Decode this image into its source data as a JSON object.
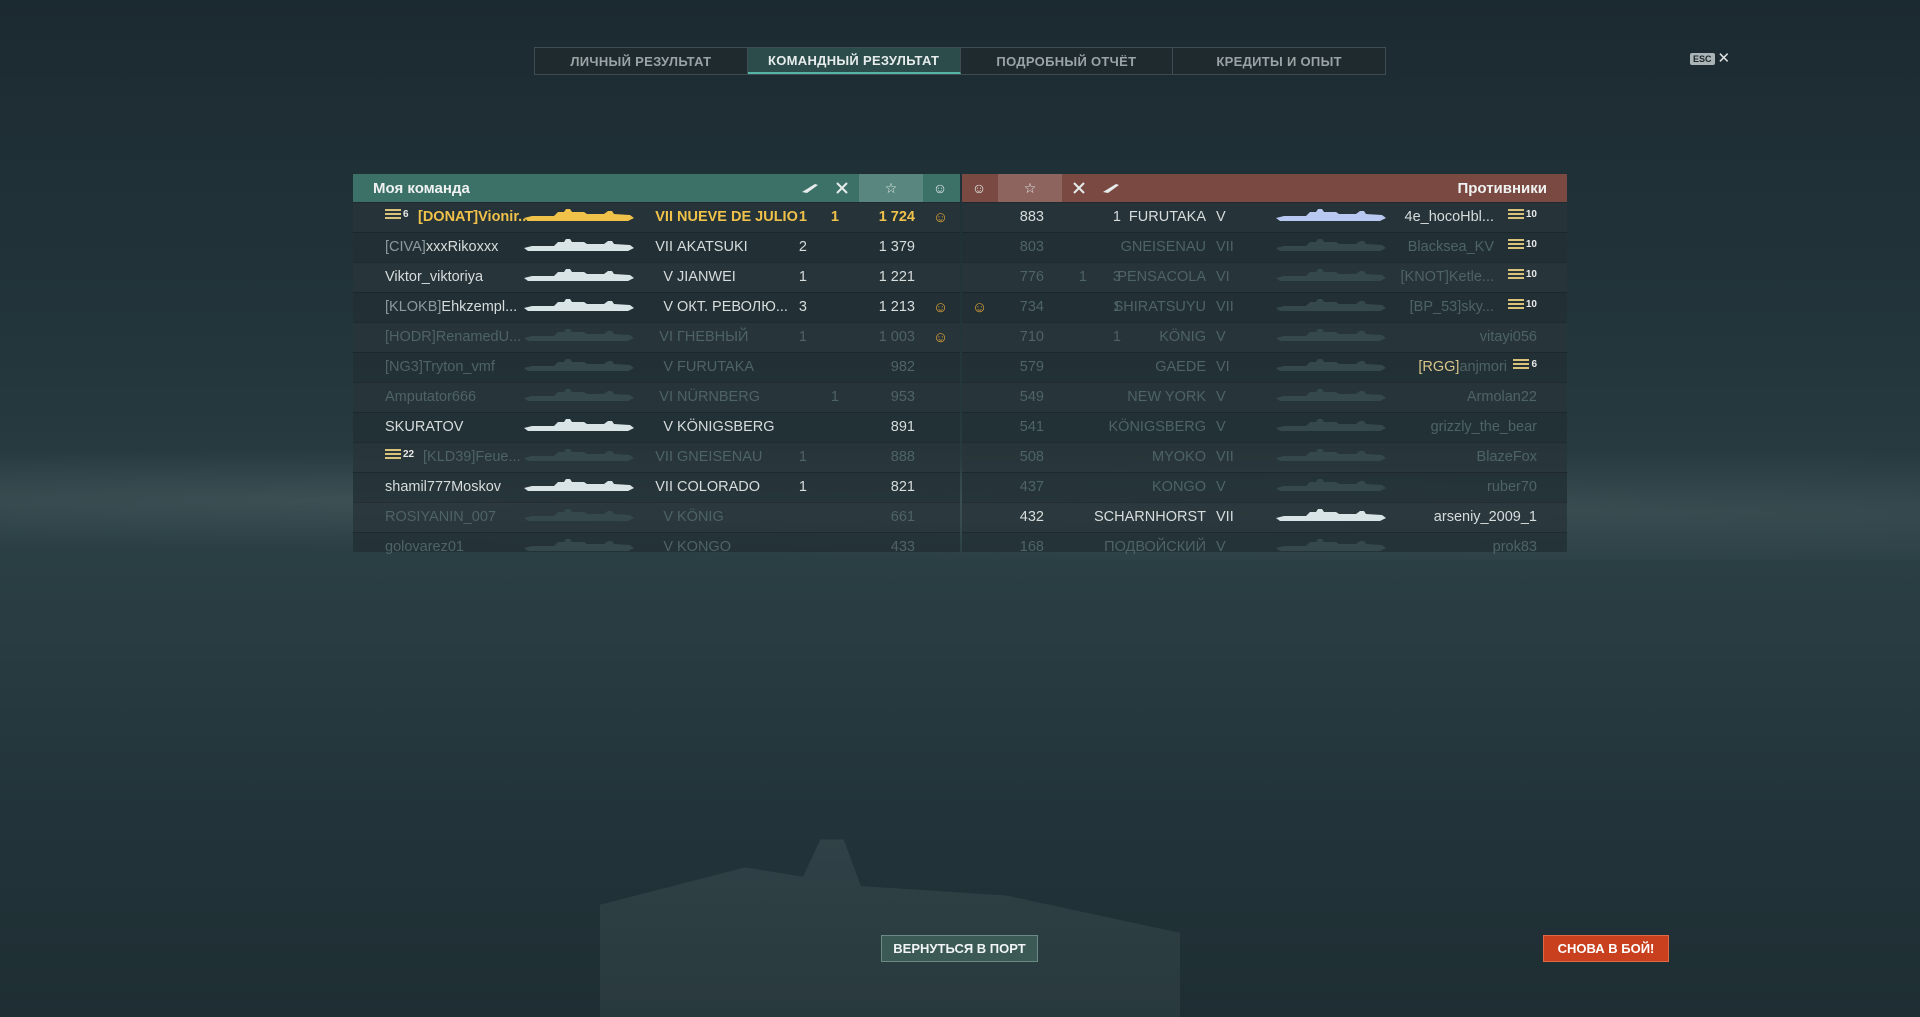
{
  "tabs": [
    {
      "label": "ЛИЧНЫЙ РЕЗУЛЬТАТ",
      "active": false
    },
    {
      "label": "КОМАНДНЫЙ РЕЗУЛЬТАТ",
      "active": true
    },
    {
      "label": "ПОДРОБНЫЙ ОТЧЁТ",
      "active": false
    },
    {
      "label": "КРЕДИТЫ И ОПЫТ",
      "active": false
    }
  ],
  "esc_label": "ESC",
  "close_glyph": "✕",
  "my_team": {
    "title": "Моя команда",
    "header_icons": [
      "ship-kill-icon",
      "plane-kill-icon",
      "star-icon",
      "smile-icon"
    ],
    "rows": [
      {
        "medal": "6",
        "clan": "[DONAT]",
        "name": "Vionir...",
        "tier": "VII",
        "ship": "NUEVE DE JULIO",
        "ships": "1",
        "planes": "1",
        "score": "1 724",
        "smile": true,
        "style": "gold"
      },
      {
        "clan": "[CIVA]",
        "name": "xxxRikoxxx",
        "tier": "VII",
        "ship": "AKATSUKI",
        "ships": "2",
        "planes": "",
        "score": "1 379",
        "smile": false,
        "style": "alive"
      },
      {
        "clan": "",
        "name": "Viktor_viktoriya",
        "tier": "V",
        "ship": "JIANWEI",
        "ships": "1",
        "planes": "",
        "score": "1 221",
        "smile": false,
        "style": "alive"
      },
      {
        "clan": "[KLOKB]",
        "name": "Ehkzempl...",
        "tier": "V",
        "ship": "ОКТ. РЕВОЛЮ...",
        "ships": "3",
        "planes": "",
        "score": "1 213",
        "smile": true,
        "style": "alive"
      },
      {
        "clan": "[HODR]",
        "name": "RenamedU...",
        "tier": "VI",
        "ship": "ГНЕВНЫЙ",
        "ships": "1",
        "planes": "",
        "score": "1 003",
        "smile": true,
        "style": "dim"
      },
      {
        "clan": "[NG3]",
        "name": "Tryton_vmf",
        "tier": "V",
        "ship": "FURUTAKA",
        "ships": "",
        "planes": "",
        "score": "982",
        "smile": false,
        "style": "dim"
      },
      {
        "clan": "",
        "name": "Amputator666",
        "tier": "VI",
        "ship": "NÜRNBERG",
        "ships": "",
        "planes": "1",
        "score": "953",
        "smile": false,
        "style": "dim"
      },
      {
        "clan": "",
        "name": "SKURATOV",
        "tier": "V",
        "ship": "KÖNIGSBERG",
        "ships": "",
        "planes": "",
        "score": "891",
        "smile": false,
        "style": "alive"
      },
      {
        "medal": "22",
        "clan": "[KLD39]",
        "name": "Feue...",
        "tier": "VII",
        "ship": "GNEISENAU",
        "ships": "1",
        "planes": "",
        "score": "888",
        "smile": false,
        "style": "dim"
      },
      {
        "clan": "",
        "name": "shamil777Moskov",
        "tier": "VII",
        "ship": "COLORADO",
        "ships": "1",
        "planes": "",
        "score": "821",
        "smile": false,
        "style": "alive"
      },
      {
        "clan": "",
        "name": "ROSIYANIN_007",
        "tier": "V",
        "ship": "KÖNIG",
        "ships": "",
        "planes": "",
        "score": "661",
        "smile": false,
        "style": "dim"
      },
      {
        "clan": "",
        "name": "golovarez01",
        "tier": "V",
        "ship": "KONGO",
        "ships": "",
        "planes": "",
        "score": "433",
        "smile": false,
        "style": "dim"
      }
    ]
  },
  "enemy_team": {
    "title": "Противники",
    "rows": [
      {
        "score": "883",
        "planes": "",
        "ships": "1",
        "ship": "FURUTAKA",
        "tier": "V",
        "clan": "",
        "name": "4e_hocoHbl...",
        "rank": "10",
        "smile": false,
        "style": "alive"
      },
      {
        "score": "803",
        "planes": "",
        "ships": "",
        "ship": "GNEISENAU",
        "tier": "VII",
        "clan": "",
        "name": "Blacksea_KV",
        "rank": "10",
        "smile": false,
        "style": "dim"
      },
      {
        "score": "776",
        "planes": "1",
        "ships": "3",
        "ship": "PENSACOLA",
        "tier": "VI",
        "clan": "[KNOT]",
        "name": "Ketle...",
        "rank": "10",
        "smile": false,
        "style": "dim"
      },
      {
        "score": "734",
        "planes": "",
        "ships": "1",
        "ship": "SHIRATSUYU",
        "tier": "VII",
        "clan": "[BP_53]",
        "name": "sky...",
        "rank": "10",
        "smile": true,
        "style": "dim"
      },
      {
        "score": "710",
        "planes": "",
        "ships": "1",
        "ship": "KÖNIG",
        "tier": "V",
        "clan": "",
        "name": "vitayi056",
        "rank": "",
        "smile": false,
        "style": "dim"
      },
      {
        "score": "579",
        "planes": "",
        "ships": "",
        "ship": "GAEDE",
        "tier": "VI",
        "clan": "[RGG]",
        "name": "anjmori",
        "rank": "6",
        "smile": false,
        "style": "dim"
      },
      {
        "score": "549",
        "planes": "",
        "ships": "",
        "ship": "NEW YORK",
        "tier": "V",
        "clan": "",
        "name": "Armolan22",
        "rank": "",
        "smile": false,
        "style": "dim"
      },
      {
        "score": "541",
        "planes": "",
        "ships": "",
        "ship": "KÖNIGSBERG",
        "tier": "V",
        "clan": "",
        "name": "grizzly_the_bear",
        "rank": "",
        "smile": false,
        "style": "dim"
      },
      {
        "score": "508",
        "planes": "",
        "ships": "",
        "ship": "MYOKO",
        "tier": "VII",
        "clan": "",
        "name": "BlazeFox",
        "rank": "",
        "smile": false,
        "style": "dim"
      },
      {
        "score": "437",
        "planes": "",
        "ships": "",
        "ship": "KONGO",
        "tier": "V",
        "clan": "",
        "name": "ruber70",
        "rank": "",
        "smile": false,
        "style": "dim"
      },
      {
        "score": "432",
        "planes": "",
        "ships": "",
        "ship": "SCHARNHORST",
        "tier": "VII",
        "clan": "",
        "name": "arseniy_2009_1",
        "rank": "",
        "smile": false,
        "style": "alive"
      },
      {
        "score": "168",
        "planes": "",
        "ships": "",
        "ship": "ПОДВОЙСКИЙ",
        "tier": "V",
        "clan": "",
        "name": "prok83",
        "rank": "",
        "smile": false,
        "style": "dim"
      }
    ]
  },
  "buttons": {
    "port": "ВЕРНУТЬСЯ В ПОРТ",
    "battle": "СНОВА В БОЙ!"
  },
  "colors": {
    "accent_green": "#3c7168",
    "accent_red": "#7a4a42",
    "battle_button": "#c8401e",
    "gold": "#f0c24a"
  }
}
